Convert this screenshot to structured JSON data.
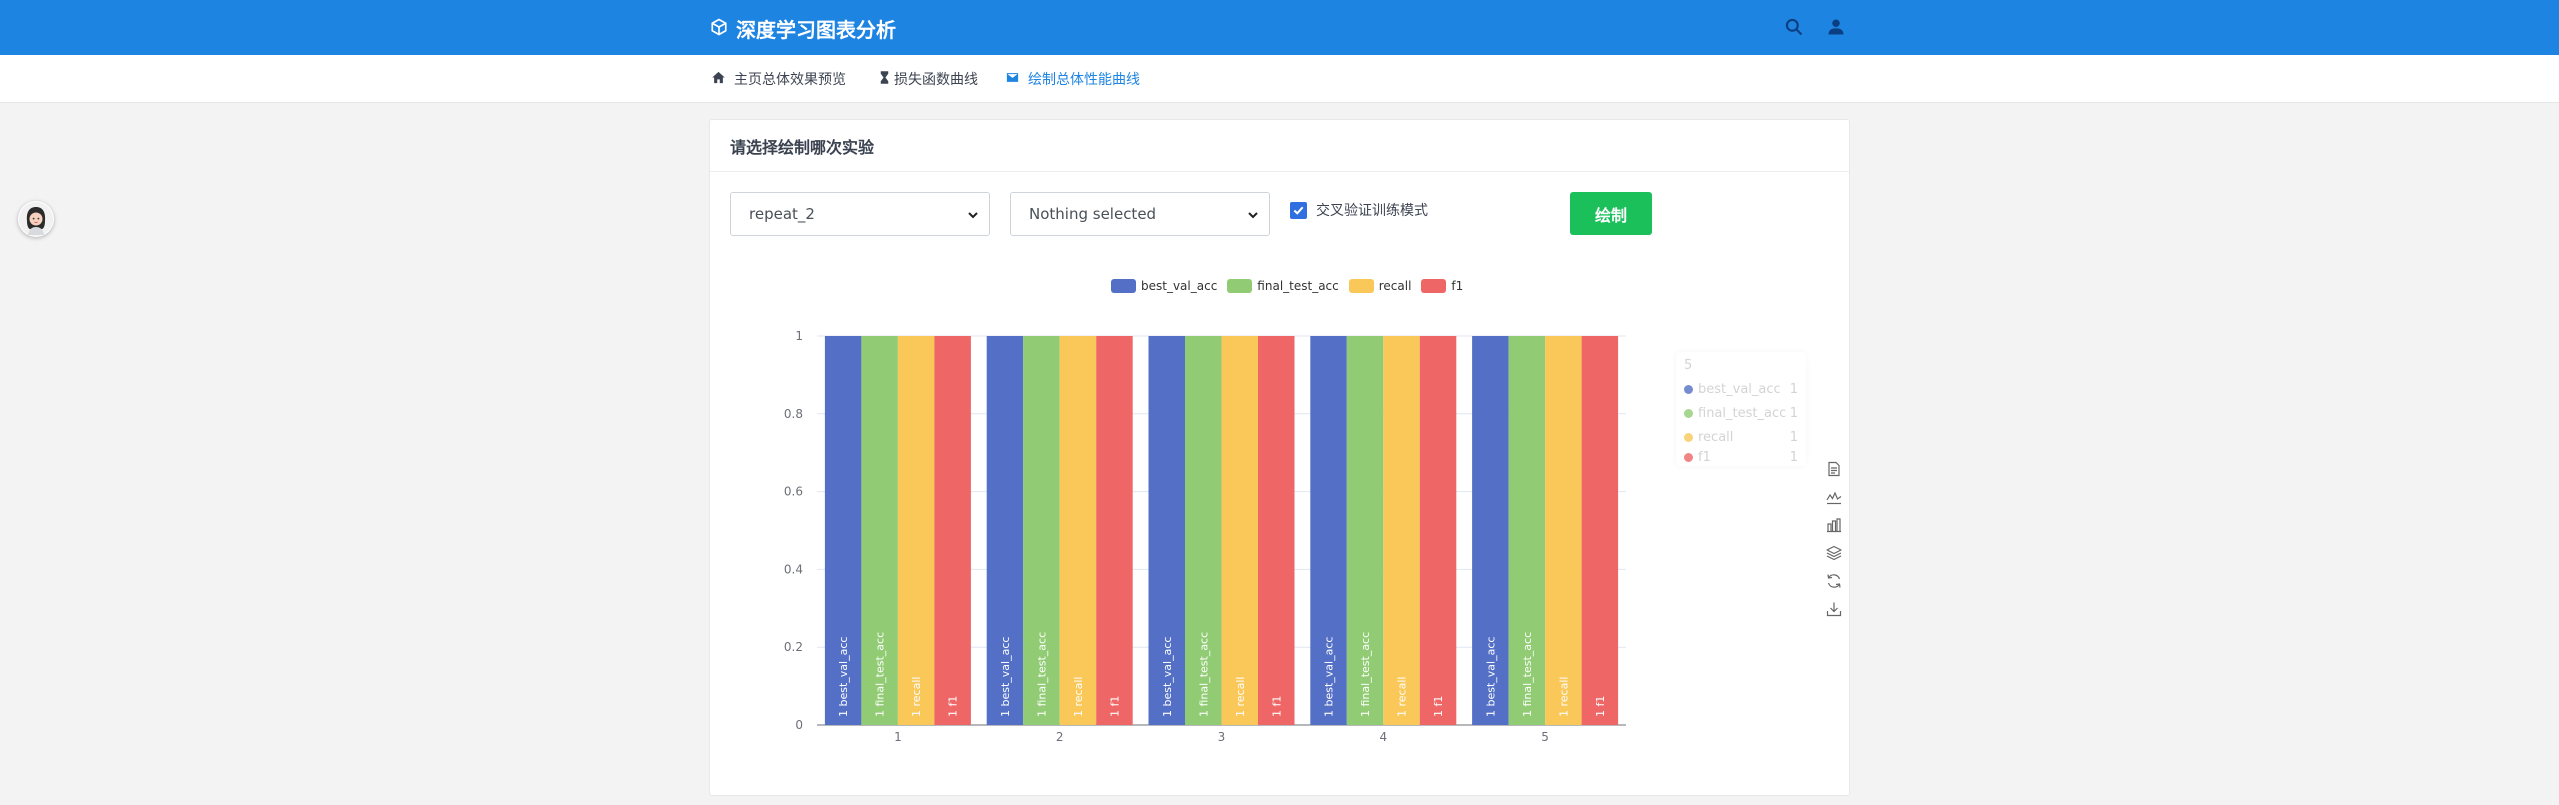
{
  "app": {
    "title": "深度学习图表分析"
  },
  "nav": [
    {
      "label": "主页总体效果预览",
      "icon": "home-icon",
      "active": false
    },
    {
      "label": "损失函数曲线",
      "icon": "hourglass-icon",
      "active": false
    },
    {
      "label": "绘制总体性能曲线",
      "icon": "mail-icon",
      "active": true
    }
  ],
  "card": {
    "title": "请选择绘制哪次实验",
    "experiment_select": {
      "value": "repeat_2"
    },
    "multi_select": {
      "value": "Nothing selected"
    },
    "cross_validation": {
      "label": "交叉验证训练模式",
      "checked": true
    },
    "draw_button": "绘制"
  },
  "colors": {
    "primary": "#1e84e2",
    "success": "#1bc05a"
  },
  "chart_data": {
    "type": "bar",
    "categories": [
      "1",
      "2",
      "3",
      "4",
      "5"
    ],
    "series": [
      {
        "name": "best_val_acc",
        "values": [
          1,
          1,
          1,
          1,
          1
        ],
        "color": "#5470c6"
      },
      {
        "name": "final_test_acc",
        "values": [
          1,
          1,
          1,
          1,
          1
        ],
        "color": "#91cc75"
      },
      {
        "name": "recall",
        "values": [
          1,
          1,
          1,
          1,
          1
        ],
        "color": "#fac858"
      },
      {
        "name": "f1",
        "values": [
          1,
          1,
          1,
          1,
          1
        ],
        "color": "#ee6666"
      }
    ],
    "ylim": [
      0,
      1
    ],
    "yticks": [
      "0",
      "0.2",
      "0.4",
      "0.6",
      "0.8",
      "1"
    ],
    "legend_position": "top-center",
    "grid": true,
    "bar_labels": "rotated series name and value inside each bar",
    "tooltip": {
      "title": "5",
      "rows": [
        {
          "name": "best_val_acc",
          "value": "1"
        },
        {
          "name": "final_test_acc",
          "value": "1"
        },
        {
          "name": "recall",
          "value": "1"
        },
        {
          "name": "f1",
          "value": "1"
        }
      ]
    }
  },
  "toolbox": [
    "data-view-icon",
    "line-chart-icon",
    "bar-chart-icon",
    "stack-icon",
    "restore-icon",
    "download-icon"
  ]
}
